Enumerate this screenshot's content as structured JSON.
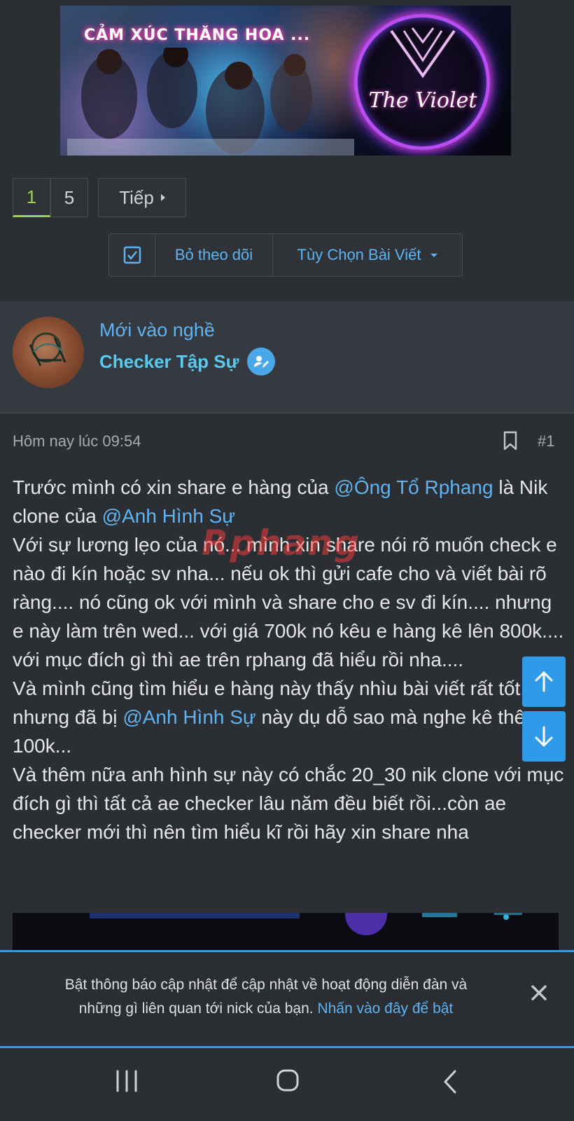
{
  "banner": {
    "tagline": "CẢM XÚC THĂNG HOA ...",
    "brand": "The Violet"
  },
  "pagination": {
    "pages": [
      "1",
      "5"
    ],
    "current": "1",
    "next_label": "Tiếp"
  },
  "thread_actions": {
    "unfollow_label": "Bỏ theo dõi",
    "options_label": "Tùy Chọn Bài Viết"
  },
  "user": {
    "title": "Mới vào nghề",
    "role": "Checker Tập Sự"
  },
  "post": {
    "timestamp": "Hôm nay lúc 09:54",
    "number": "#1",
    "watermark": "Rphang",
    "body": {
      "l1_a": "Trước mình có xin share e hàng của ",
      "l1_mention": "@Ông Tổ Rphang",
      "l1_b": " là Nik clone của ",
      "l1_mention2": "@Anh Hình Sự",
      "p2": "Với sự lương lẹo của nó... mình xin share nói rõ muốn check e nào đi kín hoặc sv nha... nếu ok thì gửi cafe cho và viết bài rõ ràng.... nó cũng ok với mình và share cho e sv đi kín.... nhưng e này làm trên wed... với giá 700k nó kêu e hàng kê lên 800k.... với mục đích gì thì ae trên rphang đã hiểu rồi nha....",
      "p3_a": "Và mình cũng tìm hiểu e hàng này thấy nhìu bài viết rất tốt.. nhưng đã bị ",
      "p3_mention": "@Anh Hình Sự",
      "p3_b": " này dụ dỗ sao mà nghe kê thêm 100k...",
      "p4": "Và thêm nữa anh hình sự này có chắc 20_30 nik clone với mục đích gì thì tất cả ae checker lâu năm đều biết rồi...còn ae checker mới thì nên tìm hiểu kĩ rồi hãy xin share nha"
    }
  },
  "notification": {
    "text": "Bật thông báo cập nhật để cập nhật về hoạt động diễn đàn và những gì liên quan tới nick của bạn. ",
    "link": "Nhấn vào đây để bật"
  },
  "colors": {
    "background": "#2b2f33",
    "accent_blue": "#5fb3f0",
    "button_blue": "#2f9ae8",
    "current_page_green": "#9acd5a"
  }
}
